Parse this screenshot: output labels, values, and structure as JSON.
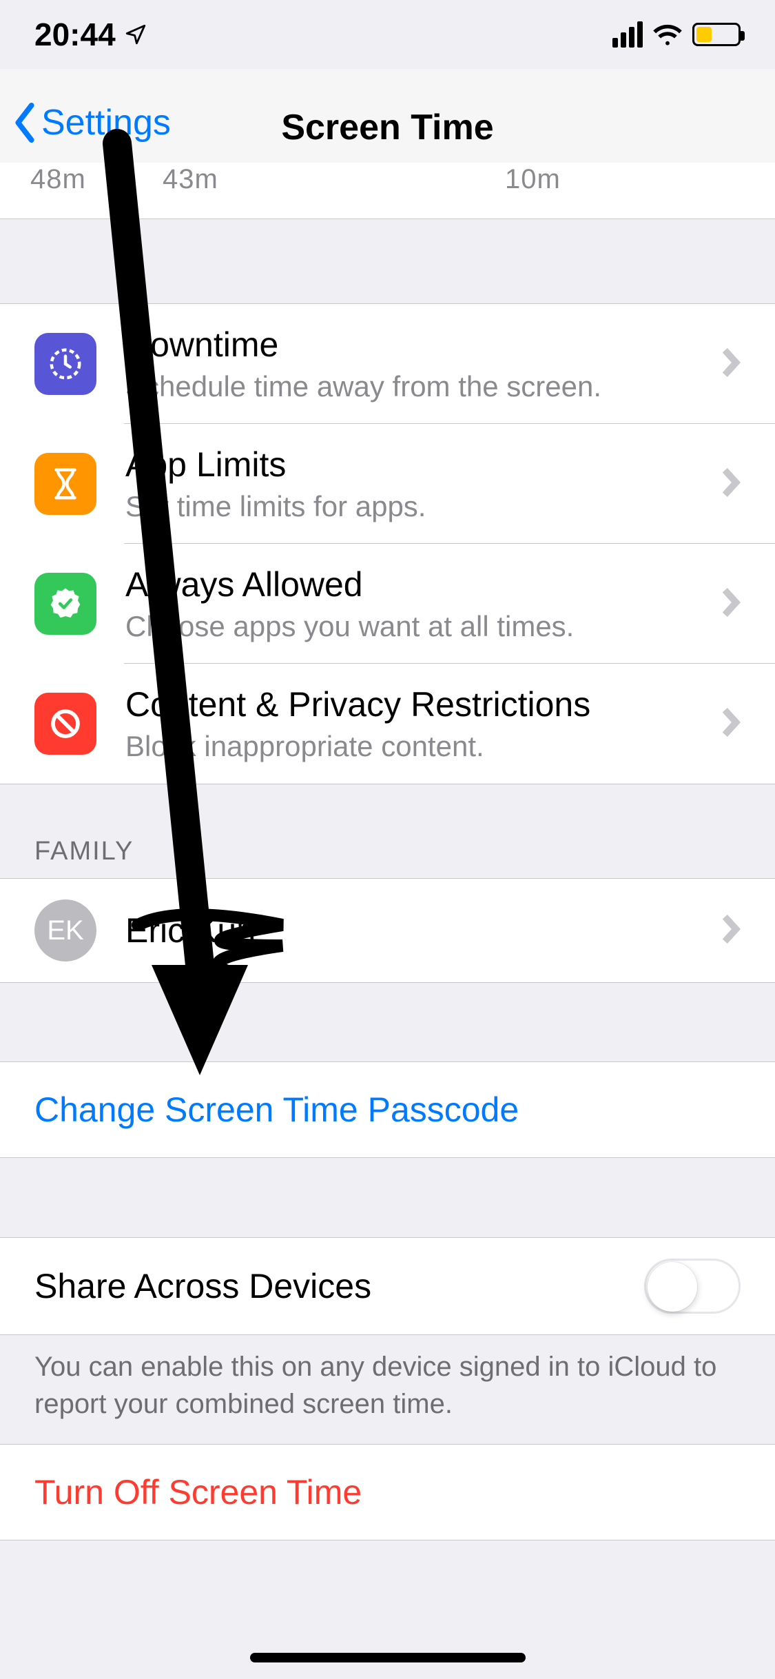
{
  "status": {
    "time": "20:44"
  },
  "nav": {
    "back": "Settings",
    "title": "Screen Time"
  },
  "chart_remnant": {
    "left": "48m",
    "mid": "43m",
    "right": "10m"
  },
  "rows": [
    {
      "title": "Downtime",
      "sub": "Schedule time away from the screen.",
      "icon": "clock-icon",
      "color": "#5856d6"
    },
    {
      "title": "App Limits",
      "sub": "Set time limits for apps.",
      "icon": "hourglass-icon",
      "color": "#ff9500"
    },
    {
      "title": "Always Allowed",
      "sub": "Choose apps you want at all times.",
      "icon": "badge-check-icon",
      "color": "#34c759"
    },
    {
      "title": "Content & Privacy Restrictions",
      "sub": "Block inappropriate content.",
      "icon": "no-entry-icon",
      "color": "#ff3b30"
    }
  ],
  "family_header": "FAMILY",
  "family": {
    "initials": "EK",
    "name": "Eric Kurt"
  },
  "change_passcode": "Change Screen Time Passcode",
  "share": {
    "title": "Share Across Devices",
    "footer": "You can enable this on any device signed in to iCloud to report your combined screen time.",
    "on": false
  },
  "turn_off": "Turn Off Screen Time",
  "annotation": "arrow pointing from top of page down to Change Screen Time Passcode, with scribble over family name"
}
